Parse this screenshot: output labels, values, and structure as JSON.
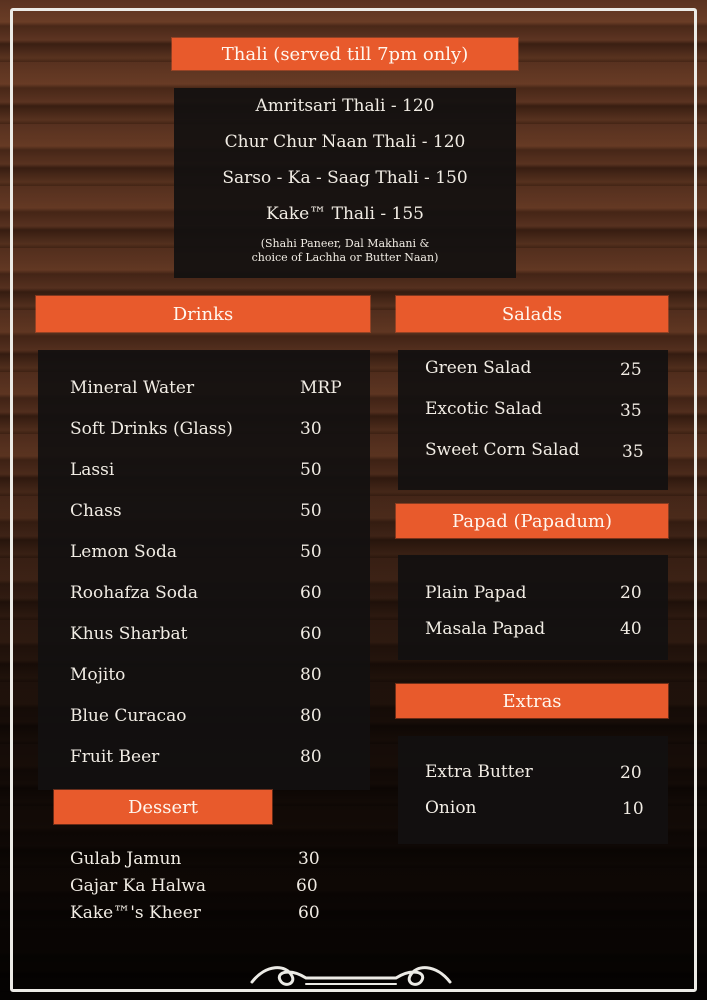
{
  "thali": {
    "title": "Thali (served till 7pm only)",
    "items": [
      "Amritsari Thali - 120",
      "Chur Chur Naan Thali - 120",
      "Sarso - Ka - Saag Thali - 150",
      "Kake™ Thali - 155"
    ],
    "note_line1": "(Shahi Paneer, Dal Makhani &",
    "note_line2": "choice of Lachha or Butter Naan)"
  },
  "drinks": {
    "title": "Drinks",
    "items": [
      {
        "name": "Mineral Water",
        "price": "MRP"
      },
      {
        "name": "Soft Drinks (Glass)",
        "price": "30"
      },
      {
        "name": "Lassi",
        "price": "50"
      },
      {
        "name": "Chass",
        "price": "50"
      },
      {
        "name": "Lemon Soda",
        "price": "50"
      },
      {
        "name": "Roohafza Soda",
        "price": "60"
      },
      {
        "name": "Khus Sharbat",
        "price": "60"
      },
      {
        "name": "Mojito",
        "price": "80"
      },
      {
        "name": "Blue Curacao",
        "price": "80"
      },
      {
        "name": "Fruit Beer",
        "price": "80"
      }
    ]
  },
  "salads": {
    "title": "Salads",
    "items": [
      {
        "name": "Green Salad",
        "price": "25"
      },
      {
        "name": "Excotic Salad",
        "price": "35"
      },
      {
        "name": "Sweet Corn Salad",
        "price": "35"
      }
    ]
  },
  "papad": {
    "title": "Papad (Papadum)",
    "items": [
      {
        "name": "Plain Papad",
        "price": "20"
      },
      {
        "name": "Masala Papad",
        "price": "40"
      }
    ]
  },
  "extras": {
    "title": "Extras",
    "items": [
      {
        "name": "Extra Butter",
        "price": "20"
      },
      {
        "name": "Onion",
        "price": "10"
      }
    ]
  },
  "dessert": {
    "title": "Dessert",
    "items": [
      {
        "name": "Gulab Jamun",
        "price": "30"
      },
      {
        "name": "Gajar Ka Halwa",
        "price": "60"
      },
      {
        "name": "Kake™'s Kheer",
        "price": "60"
      }
    ]
  },
  "colors": {
    "banner": "#e85a2c",
    "panel": "#121010",
    "text": "#f1ece4",
    "frame": "#ecebe6"
  },
  "icons": {
    "footer": "scroll-ornament-icon"
  }
}
